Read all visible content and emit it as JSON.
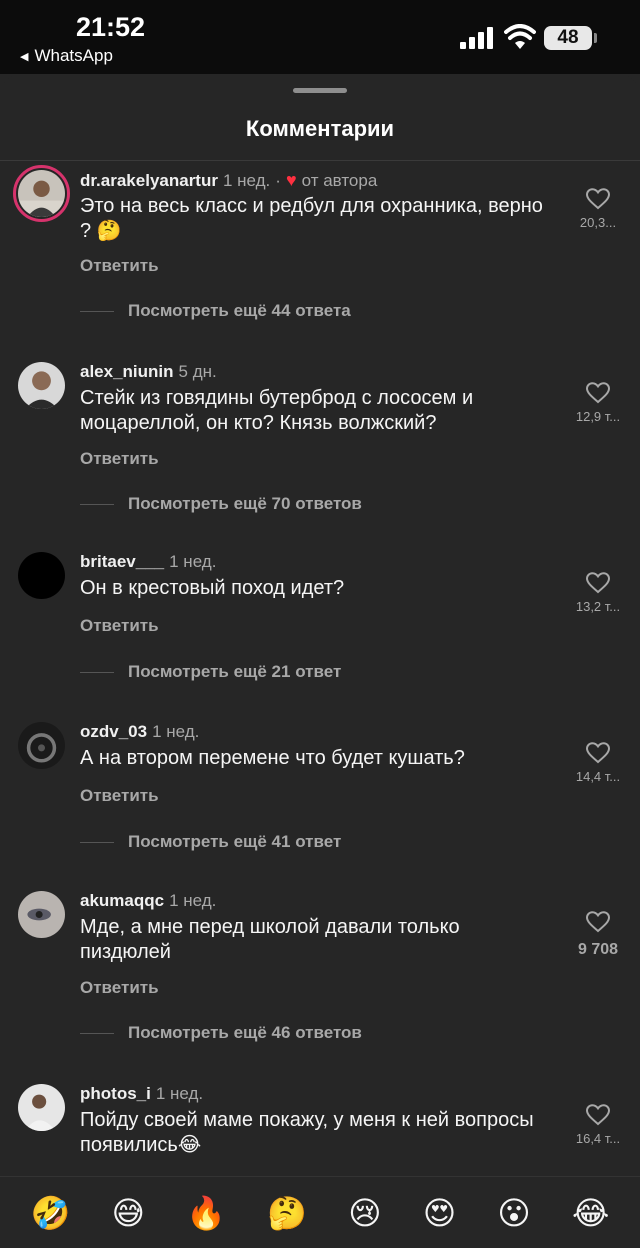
{
  "status_bar": {
    "time": "21:52",
    "back_app": "WhatsApp",
    "battery": "48"
  },
  "sheet": {
    "title": "Комментарии"
  },
  "comments": [
    {
      "username": "dr.arakelyanartur",
      "time": "1 нед.",
      "author_badge": "от автора",
      "text": "Это на весь класс и редбул для охранника, верно ? 🤔",
      "likes": "20,3...",
      "reply_label": "Ответить",
      "more_replies": "Посмотреть ещё 44 ответа"
    },
    {
      "username": "alex_niunin",
      "time": "5 дн.",
      "text": "Стейк из говядины бутерброд с лососем и моцареллой, он кто? Князь волжский?",
      "likes": "12,9 т...",
      "reply_label": "Ответить",
      "more_replies": "Посмотреть ещё 70 ответов"
    },
    {
      "username": "britaev___",
      "time": "1 нед.",
      "text": "Он в крестовый поход идет?",
      "likes": "13,2 т...",
      "reply_label": "Ответить",
      "more_replies": "Посмотреть ещё 21 ответ"
    },
    {
      "username": "ozdv_03",
      "time": "1 нед.",
      "text": "А на втором перемене что будет кушать?",
      "likes": "14,4 т...",
      "reply_label": "Ответить",
      "more_replies": "Посмотреть ещё 41 ответ"
    },
    {
      "username": "akumaqqc",
      "time": "1 нед.",
      "text": "Мде, а мне перед школой давали только пиздюлей",
      "likes": "9 708",
      "reply_label": "Ответить",
      "more_replies": "Посмотреть ещё 46 ответов"
    },
    {
      "username": "photos_i",
      "time": "1 нед.",
      "text": "Пойду своей маме покажу, у меня к ней вопросы появились😂",
      "likes": "16,4 т..."
    }
  ],
  "emoji_bar": [
    "🤣",
    "😅",
    "🔥",
    "🤔",
    "😢",
    "😍",
    "😮",
    "😂"
  ],
  "colors": {
    "background": "#262626",
    "accent_heart": "#ff3040",
    "secondary_text": "#a8a8a8"
  }
}
